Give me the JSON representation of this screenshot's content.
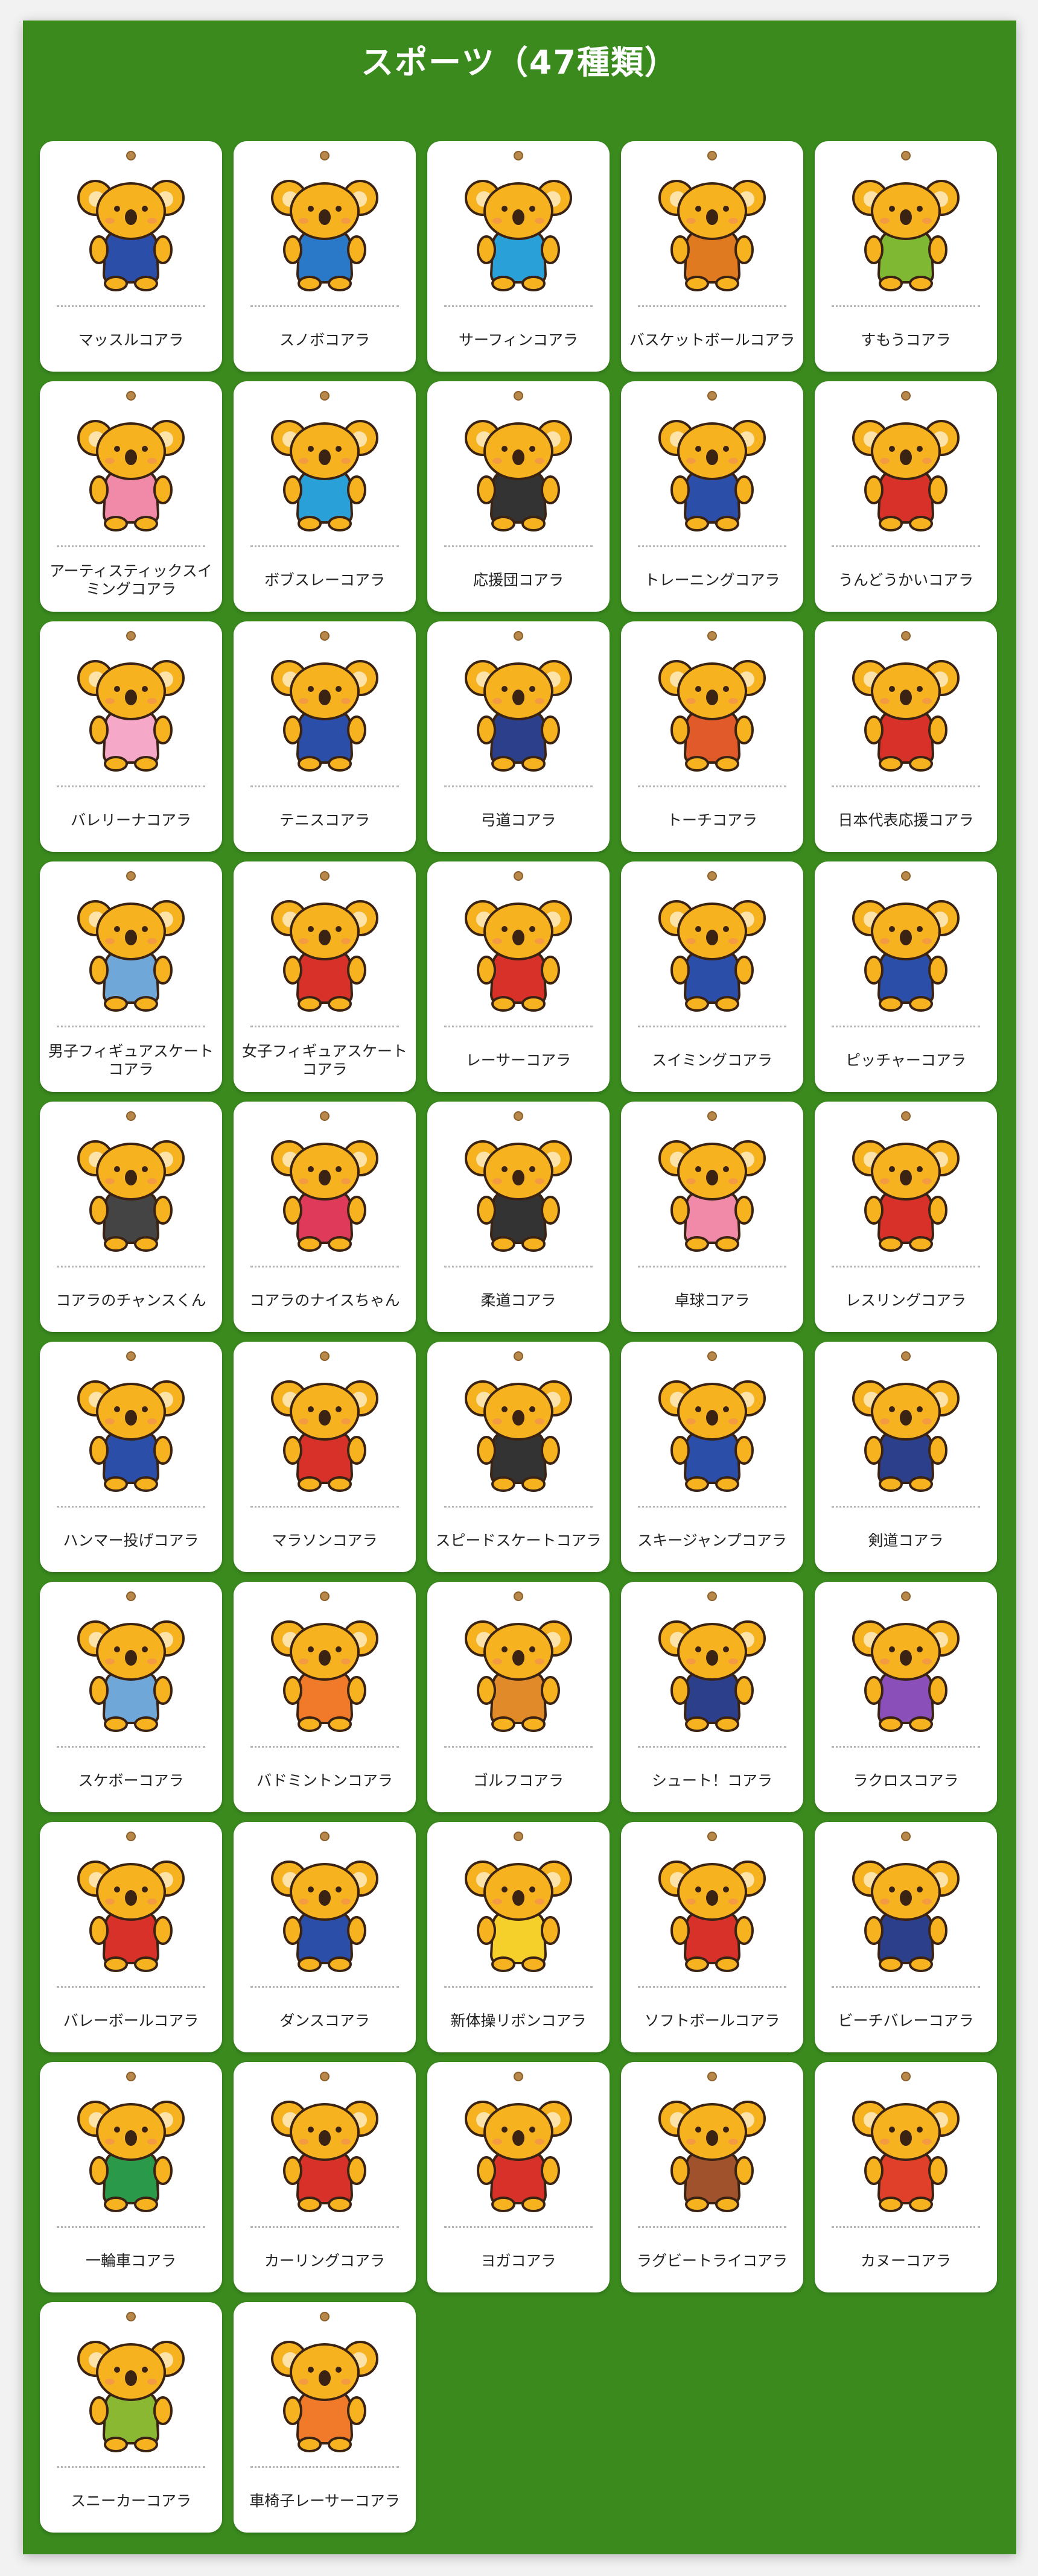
{
  "header": {
    "title": "スポーツ（47種類）"
  },
  "colors": {
    "background": "#3a8a1e",
    "card": "#ffffff",
    "koala": "#f7b21f",
    "outline": "#3b2314"
  },
  "cards": [
    {
      "label": "マッスルコアラ",
      "accent": "#2b4fa8",
      "icon": "muscle-koala-icon"
    },
    {
      "label": "スノボコアラ",
      "accent": "#2a78c8",
      "icon": "snowboard-koala-icon"
    },
    {
      "label": "サーフィンコアラ",
      "accent": "#2aa0d8",
      "icon": "surfing-koala-icon"
    },
    {
      "label": "バスケットボールコアラ",
      "accent": "#e07a20",
      "icon": "basketball-koala-icon"
    },
    {
      "label": "すもうコアラ",
      "accent": "#7fb832",
      "icon": "sumo-koala-icon"
    },
    {
      "label": "アーティスティックスイミングコアラ",
      "accent": "#f08aa8",
      "icon": "artistic-swimming-koala-icon"
    },
    {
      "label": "ボブスレーコアラ",
      "accent": "#2aa0d8",
      "icon": "bobsleigh-koala-icon"
    },
    {
      "label": "応援団コアラ",
      "accent": "#333333",
      "icon": "cheer-squad-koala-icon"
    },
    {
      "label": "トレーニングコアラ",
      "accent": "#2b4fa8",
      "icon": "training-koala-icon"
    },
    {
      "label": "うんどうかいコアラ",
      "accent": "#d8312a",
      "icon": "sports-day-koala-icon"
    },
    {
      "label": "バレリーナコアラ",
      "accent": "#f5a8c8",
      "icon": "ballerina-koala-icon"
    },
    {
      "label": "テニスコアラ",
      "accent": "#2b4fa8",
      "icon": "tennis-koala-icon"
    },
    {
      "label": "弓道コアラ",
      "accent": "#2b3f8a",
      "icon": "kyudo-koala-icon"
    },
    {
      "label": "トーチコアラ",
      "accent": "#e05a2a",
      "icon": "torch-koala-icon"
    },
    {
      "label": "日本代表応援コアラ",
      "accent": "#d8312a",
      "icon": "japan-supporter-koala-icon"
    },
    {
      "label": "男子フィギュアスケートコアラ",
      "accent": "#6fa8d8",
      "icon": "mens-figure-skating-koala-icon"
    },
    {
      "label": "女子フィギュアスケートコアラ",
      "accent": "#d8312a",
      "icon": "womens-figure-skating-koala-icon"
    },
    {
      "label": "レーサーコアラ",
      "accent": "#d8312a",
      "icon": "racer-koala-icon"
    },
    {
      "label": "スイミングコアラ",
      "accent": "#2b4fa8",
      "icon": "swimming-koala-icon"
    },
    {
      "label": "ピッチャーコアラ",
      "accent": "#2b4fa8",
      "icon": "pitcher-koala-icon"
    },
    {
      "label": "コアラのチャンスくん",
      "accent": "#444444",
      "icon": "chance-kun-koala-icon"
    },
    {
      "label": "コアラのナイスちゃん",
      "accent": "#e03a5a",
      "icon": "nice-chan-koala-icon"
    },
    {
      "label": "柔道コアラ",
      "accent": "#333333",
      "icon": "judo-koala-icon"
    },
    {
      "label": "卓球コアラ",
      "accent": "#f08aa8",
      "icon": "table-tennis-koala-icon"
    },
    {
      "label": "レスリングコアラ",
      "accent": "#d8312a",
      "icon": "wrestling-koala-icon"
    },
    {
      "label": "ハンマー投げコアラ",
      "accent": "#2b4fa8",
      "icon": "hammer-throw-koala-icon"
    },
    {
      "label": "マラソンコアラ",
      "accent": "#d8312a",
      "icon": "marathon-koala-icon"
    },
    {
      "label": "スピードスケートコアラ",
      "accent": "#333333",
      "icon": "speed-skating-koala-icon"
    },
    {
      "label": "スキージャンプコアラ",
      "accent": "#2b4fa8",
      "icon": "ski-jump-koala-icon"
    },
    {
      "label": "剣道コアラ",
      "accent": "#2b3f8a",
      "icon": "kendo-koala-icon"
    },
    {
      "label": "スケボーコアラ",
      "accent": "#6fa8d8",
      "icon": "skateboard-koala-icon"
    },
    {
      "label": "バドミントンコアラ",
      "accent": "#f07a2a",
      "icon": "badminton-koala-icon"
    },
    {
      "label": "ゴルフコアラ",
      "accent": "#e08a2a",
      "icon": "golf-koala-icon"
    },
    {
      "label": "シュート！コアラ",
      "accent": "#2b3f8a",
      "icon": "soccer-shoot-koala-icon"
    },
    {
      "label": "ラクロスコアラ",
      "accent": "#8a4fb8",
      "icon": "lacrosse-koala-icon"
    },
    {
      "label": "バレーボールコアラ",
      "accent": "#d8312a",
      "icon": "volleyball-koala-icon"
    },
    {
      "label": "ダンスコアラ",
      "accent": "#2b4fa8",
      "icon": "dance-koala-icon"
    },
    {
      "label": "新体操リボンコアラ",
      "accent": "#f5d02a",
      "icon": "rhythmic-gymnastics-koala-icon"
    },
    {
      "label": "ソフトボールコアラ",
      "accent": "#d8312a",
      "icon": "softball-koala-icon"
    },
    {
      "label": "ビーチバレーコアラ",
      "accent": "#2b3f8a",
      "icon": "beach-volleyball-koala-icon"
    },
    {
      "label": "一輪車コアラ",
      "accent": "#2a9a4a",
      "icon": "unicycle-koala-icon"
    },
    {
      "label": "カーリングコアラ",
      "accent": "#d8312a",
      "icon": "curling-koala-icon"
    },
    {
      "label": "ヨガコアラ",
      "accent": "#d8312a",
      "icon": "yoga-koala-icon"
    },
    {
      "label": "ラグビートライコアラ",
      "accent": "#a0522d",
      "icon": "rugby-try-koala-icon"
    },
    {
      "label": "カヌーコアラ",
      "accent": "#e0402a",
      "icon": "canoe-koala-icon"
    },
    {
      "label": "スニーカーコアラ",
      "accent": "#8ab832",
      "icon": "sneaker-koala-icon"
    },
    {
      "label": "車椅子レーサーコアラ",
      "accent": "#f07a2a",
      "icon": "wheelchair-racer-koala-icon"
    }
  ]
}
